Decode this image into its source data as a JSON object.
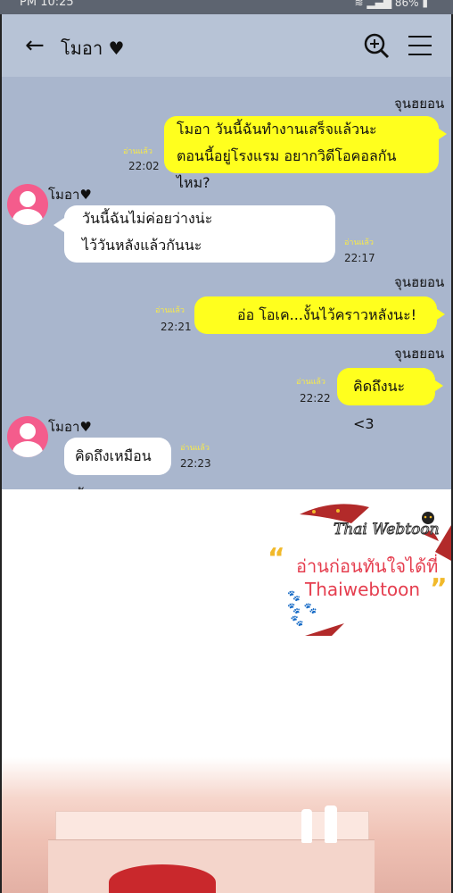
{
  "status_bar": {
    "time": "PM 10:25",
    "battery": "86%"
  },
  "chat": {
    "contact_name": "โมอา ♥",
    "messages": [
      {
        "sender": "จุนฮยอน",
        "lines": [
          "โมอา  วันนี้ฉันทำงานเสร็จแล้วนะ",
          "ตอนนี้อยู่โรงแรม  อยากวิดีโอคอลกันไหม?"
        ],
        "read": "อ่านแล้ว",
        "time": "22:02"
      },
      {
        "sender": "โมอา♥",
        "lines": [
          "วันนี้ฉันไม่ค่อยว่างน่ะ",
          "ไว้วันหลังแล้วกันนะ"
        ],
        "read": "อ่านแล้ว",
        "time": "22:17"
      },
      {
        "sender": "จุนฮยอน",
        "lines": [
          "อ่อ  โอเค...งั้นไว้คราวหลังนะ!"
        ],
        "read": "อ่านแล้ว",
        "time": "22:21"
      },
      {
        "sender": "จุนฮยอน",
        "lines": [
          "คิดถึงนะ <3"
        ],
        "read": "อ่านแล้ว",
        "time": "22:22"
      },
      {
        "sender": "โมอา♥",
        "lines": [
          "คิดถึงเหมือนกัน"
        ],
        "read": "อ่านแล้ว",
        "time": "22:23"
      }
    ]
  },
  "promo": {
    "logo": "Thai Webtoon",
    "line1": "อ่านก่อนทันใจได้ที่",
    "line2": "Thaiwebtoon"
  },
  "colors": {
    "chat_bg": "#a9b6cd",
    "mine_bubble": "#ffff1e",
    "theirs_bubble": "#ffffff",
    "avatar": "#f45c8c",
    "promo_text": "#e53e4f"
  }
}
